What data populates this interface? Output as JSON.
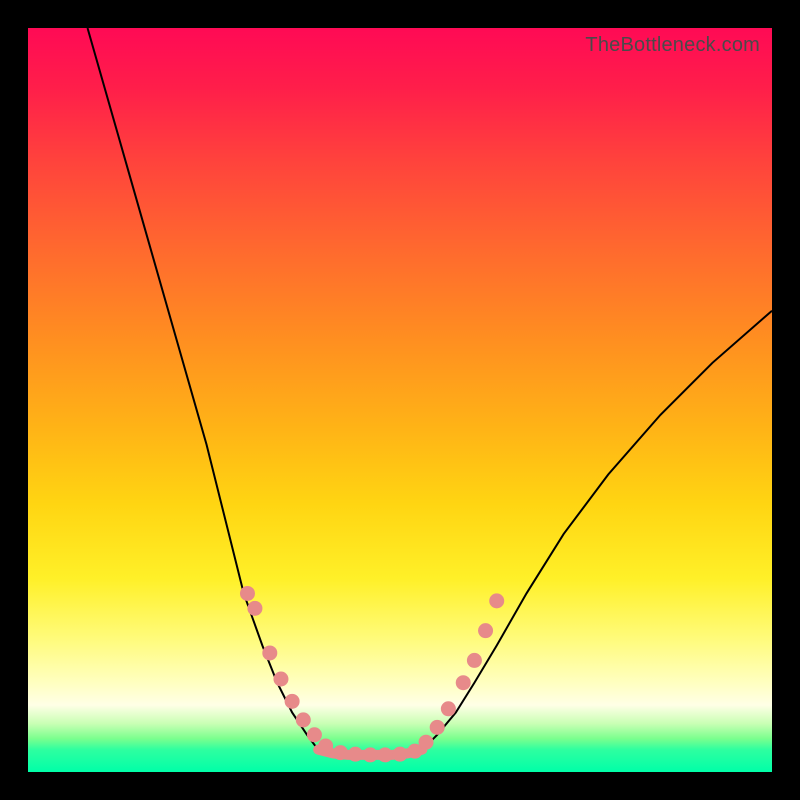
{
  "watermark": "TheBottleneck.com",
  "colors": {
    "frame": "#000000",
    "curve": "#000000",
    "markers": "#e78a8a",
    "gradient_top": "#ff0a55",
    "gradient_bottom": "#00ffa8"
  },
  "chart_data": {
    "type": "line",
    "title": "",
    "xlabel": "",
    "ylabel": "",
    "xlim": [
      0,
      100
    ],
    "ylim": [
      0,
      100
    ],
    "note": "Axes are unlabeled. Values below are approximate coordinates read off the plot (0–100 on each axis; y=0 is the bottom green band, y=100 is the top edge).",
    "series": [
      {
        "name": "left-curve",
        "x": [
          8,
          12,
          16,
          20,
          24,
          27,
          29,
          31.5,
          33.5,
          35.5,
          37.5,
          39
        ],
        "values": [
          100,
          86,
          72,
          58,
          44,
          32,
          24,
          17,
          12,
          8,
          5,
          3
        ]
      },
      {
        "name": "valley-floor",
        "x": [
          39,
          41,
          43,
          45,
          47,
          49,
          51,
          53
        ],
        "values": [
          3,
          2.5,
          2.3,
          2.3,
          2.3,
          2.3,
          2.5,
          3
        ]
      },
      {
        "name": "right-curve",
        "x": [
          53,
          55,
          57.5,
          60,
          63,
          67,
          72,
          78,
          85,
          92,
          100
        ],
        "values": [
          3,
          5,
          8,
          12,
          17,
          24,
          32,
          40,
          48,
          55,
          62
        ]
      }
    ],
    "markers": {
      "name": "highlighted-points",
      "note": "Salmon circular markers clustered near the valley walls and along the flat bottom.",
      "x": [
        29.5,
        30.5,
        32.5,
        34,
        35.5,
        37,
        38.5,
        40,
        42,
        44,
        46,
        48,
        50,
        52,
        53.5,
        55,
        56.5,
        58.5,
        60,
        61.5,
        63
      ],
      "values": [
        24,
        22,
        16,
        12.5,
        9.5,
        7,
        5,
        3.5,
        2.6,
        2.4,
        2.3,
        2.3,
        2.4,
        2.8,
        4,
        6,
        8.5,
        12,
        15,
        19,
        23
      ]
    }
  }
}
